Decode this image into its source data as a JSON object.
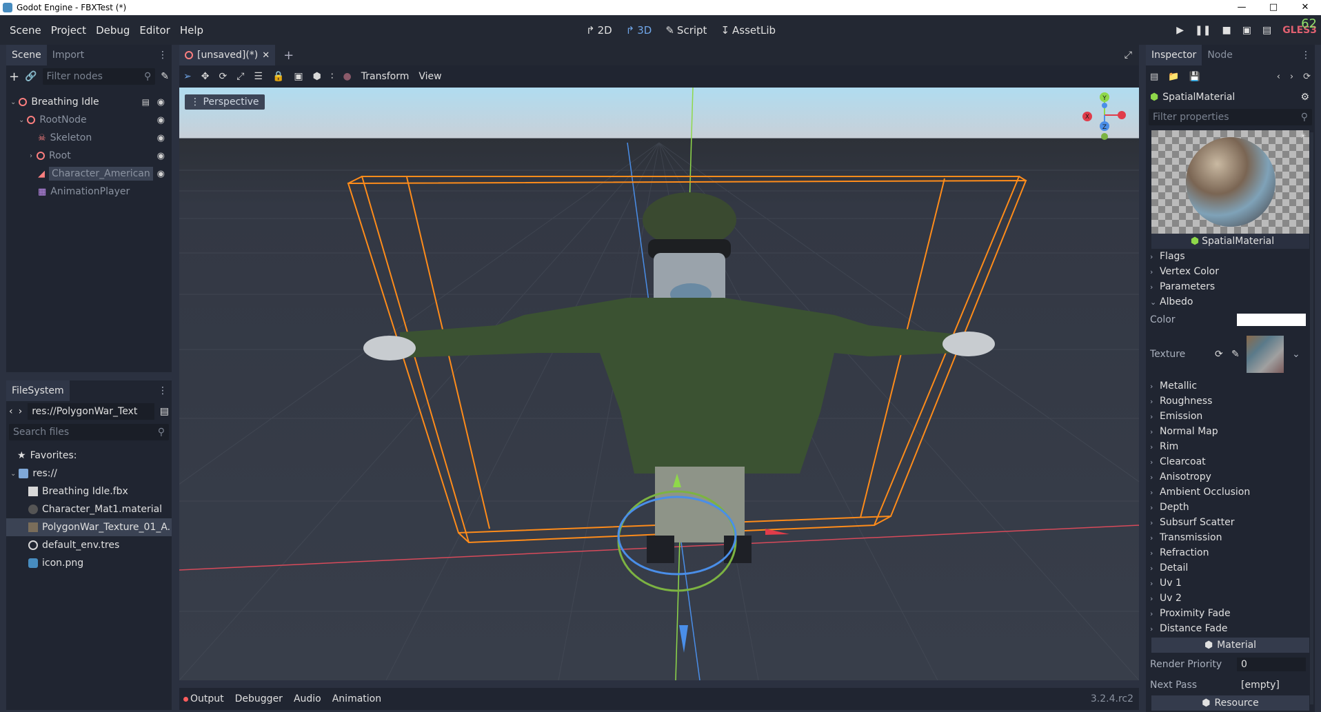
{
  "window": {
    "title": "Godot Engine - FBXTest (*)",
    "minimize": "—",
    "maximize": "□",
    "close": "✕"
  },
  "menubar": {
    "items": [
      "Scene",
      "Project",
      "Debug",
      "Editor",
      "Help"
    ],
    "workspaces": [
      {
        "label": "2D",
        "active": false
      },
      {
        "label": "3D",
        "active": true
      },
      {
        "label": "Script",
        "active": false
      },
      {
        "label": "AssetLib",
        "active": false
      }
    ],
    "renderer": "GLES3",
    "fps": "62"
  },
  "scene_dock": {
    "tabs": [
      "Scene",
      "Import"
    ],
    "filter_placeholder": "Filter nodes",
    "nodes": [
      {
        "label": "Breathing Idle",
        "type": "spatial"
      },
      {
        "label": "RootNode",
        "type": "spatial"
      },
      {
        "label": "Skeleton",
        "type": "skeleton"
      },
      {
        "label": "Root",
        "type": "spatial"
      },
      {
        "label": "Character_American",
        "type": "mesh"
      },
      {
        "label": "AnimationPlayer",
        "type": "animation"
      }
    ]
  },
  "filesystem_dock": {
    "title": "FileSystem",
    "path": "res://PolygonWar_Text",
    "search_placeholder": "Search files",
    "items": [
      {
        "label": "Favorites:",
        "icon": "star-icon"
      },
      {
        "label": "res://",
        "icon": "folder-icon"
      },
      {
        "label": "Breathing Idle.fbx",
        "icon": "scene-icon"
      },
      {
        "label": "Character_Mat1.material",
        "icon": "material-icon"
      },
      {
        "label": "PolygonWar_Texture_01_A.",
        "icon": "texture-icon"
      },
      {
        "label": "default_env.tres",
        "icon": "environment-icon"
      },
      {
        "label": "icon.png",
        "icon": "image-icon"
      }
    ]
  },
  "editor": {
    "scene_tab": "[unsaved](*)",
    "toolbar_menus": [
      "Transform",
      "View"
    ],
    "viewport_label": "Perspective",
    "gizmo_axes": [
      "X",
      "Y",
      "Z"
    ]
  },
  "bottom_panel": {
    "tabs": [
      "Output",
      "Debugger",
      "Audio",
      "Animation"
    ],
    "version": "3.2.4.rc2"
  },
  "inspector": {
    "tabs": [
      "Inspector",
      "Node"
    ],
    "resource_type": "SpatialMaterial",
    "filter_placeholder": "Filter properties",
    "preview_label": "SpatialMaterial",
    "sections": [
      "Flags",
      "Vertex Color",
      "Parameters"
    ],
    "albedo": "Albedo",
    "albedo_color_label": "Color",
    "albedo_color_value": "#ffffff",
    "albedo_texture_label": "Texture",
    "more_sections": [
      "Metallic",
      "Roughness",
      "Emission",
      "Normal Map",
      "Rim",
      "Clearcoat",
      "Anisotropy",
      "Ambient Occlusion",
      "Depth",
      "Subsurf Scatter",
      "Transmission",
      "Refraction",
      "Detail",
      "Uv 1",
      "Uv 2",
      "Proximity Fade",
      "Distance Fade"
    ],
    "material_section": "Material",
    "render_priority_label": "Render Priority",
    "render_priority_value": "0",
    "next_pass_label": "Next Pass",
    "next_pass_value": "[empty]",
    "resource_section": "Resource"
  },
  "colors": {
    "accent": "#70a6e8",
    "node_spatial": "#fc7f7f",
    "selection_box": "#ff8c1a",
    "panel_bg": "#202531"
  }
}
